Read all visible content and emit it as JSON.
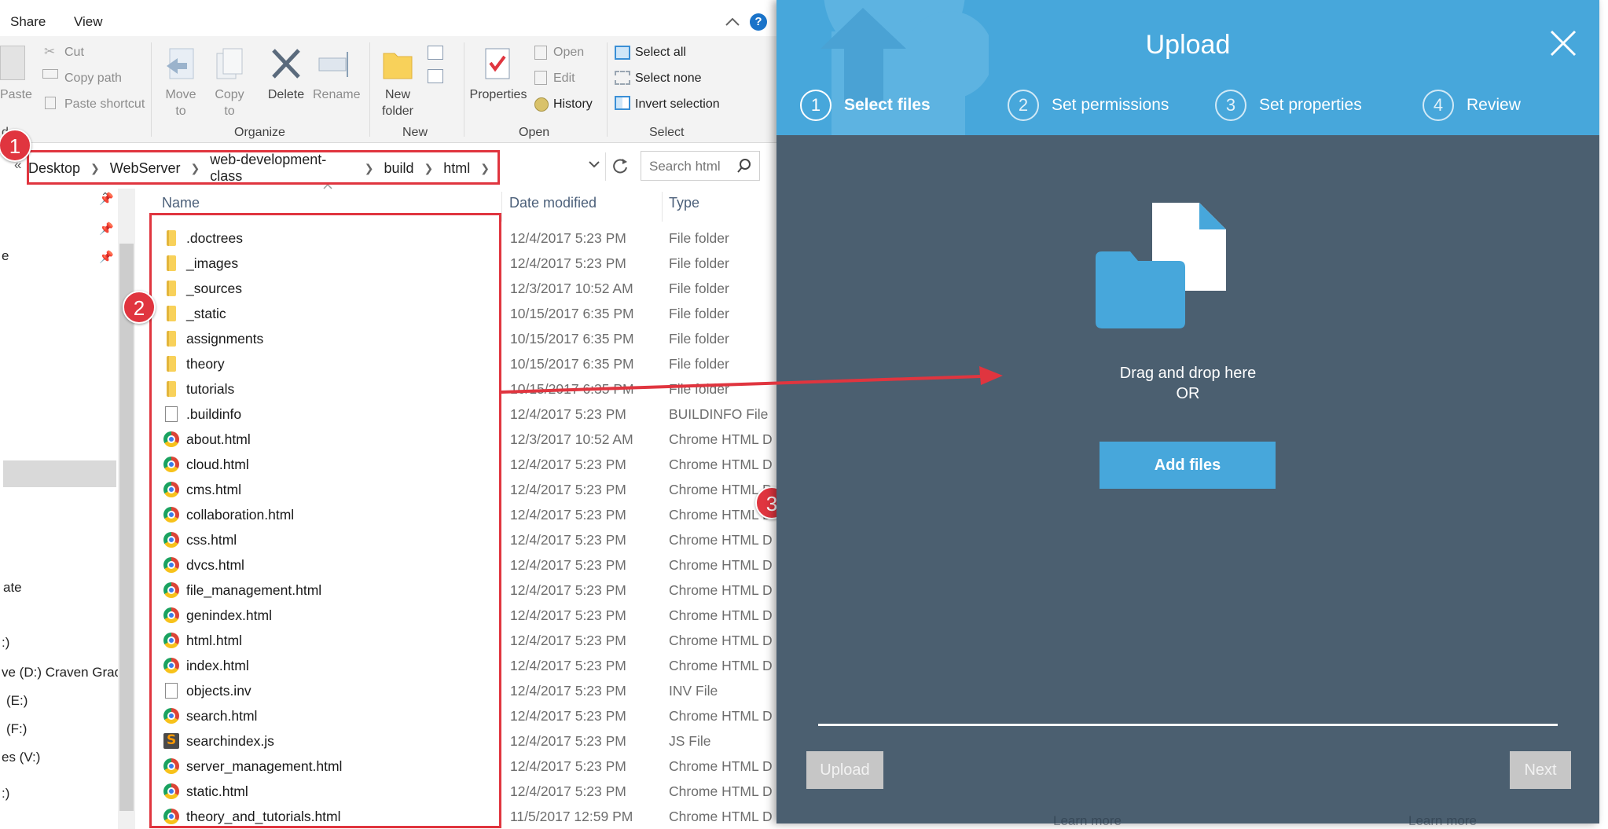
{
  "explorer": {
    "menu": [
      "Share",
      "View"
    ],
    "ribbon": {
      "clipboard": {
        "paste": "Paste",
        "cut": "Cut",
        "copy_path": "Copy path",
        "paste_shortcut": "Paste shortcut",
        "group_fragment": "d"
      },
      "organize": {
        "move_to": "Move to",
        "copy_to": "Copy to",
        "delete": "Delete",
        "rename": "Rename",
        "group": "Organize"
      },
      "new": {
        "new_folder_line1": "New",
        "new_folder_line2": "folder",
        "group": "New"
      },
      "open": {
        "properties": "Properties",
        "open": "Open",
        "edit": "Edit",
        "history": "History",
        "group": "Open"
      },
      "select": {
        "select_all": "Select all",
        "select_none": "Select none",
        "invert_selection": "Invert selection",
        "group": "Select"
      }
    },
    "breadcrumb": [
      "Desktop",
      "WebServer",
      "web-development-class",
      "build",
      "html"
    ],
    "search_placeholder": "Search html",
    "nav_fragments": [
      "e",
      "ate",
      ":)",
      "ve (D:) Craven Grad",
      "(E:)",
      "(F:)",
      "es (V:)",
      ":)"
    ],
    "columns": {
      "name": "Name",
      "date": "Date modified",
      "type": "Type"
    },
    "files": [
      {
        "name": ".doctrees",
        "date": "12/4/2017 5:23 PM",
        "type": "File folder",
        "icon": "folder-icon"
      },
      {
        "name": "_images",
        "date": "12/4/2017 5:23 PM",
        "type": "File folder",
        "icon": "folder-icon"
      },
      {
        "name": "_sources",
        "date": "12/3/2017 10:52 AM",
        "type": "File folder",
        "icon": "folder-icon"
      },
      {
        "name": "_static",
        "date": "10/15/2017 6:35 PM",
        "type": "File folder",
        "icon": "folder-icon"
      },
      {
        "name": "assignments",
        "date": "10/15/2017 6:35 PM",
        "type": "File folder",
        "icon": "folder-icon"
      },
      {
        "name": "theory",
        "date": "10/15/2017 6:35 PM",
        "type": "File folder",
        "icon": "folder-icon"
      },
      {
        "name": "tutorials",
        "date": "10/15/2017 6:35 PM",
        "type": "File folder",
        "icon": "folder-icon"
      },
      {
        "name": ".buildinfo",
        "date": "12/4/2017 5:23 PM",
        "type": "BUILDINFO File",
        "icon": "file-icon"
      },
      {
        "name": "about.html",
        "date": "12/3/2017 10:52 AM",
        "type": "Chrome HTML D",
        "icon": "chrome-icon"
      },
      {
        "name": "cloud.html",
        "date": "12/4/2017 5:23 PM",
        "type": "Chrome HTML D",
        "icon": "chrome-icon"
      },
      {
        "name": "cms.html",
        "date": "12/4/2017 5:23 PM",
        "type": "Chrome HTML D",
        "icon": "chrome-icon"
      },
      {
        "name": "collaboration.html",
        "date": "12/4/2017 5:23 PM",
        "type": "Chrome HTML D",
        "icon": "chrome-icon"
      },
      {
        "name": "css.html",
        "date": "12/4/2017 5:23 PM",
        "type": "Chrome HTML D",
        "icon": "chrome-icon"
      },
      {
        "name": "dvcs.html",
        "date": "12/4/2017 5:23 PM",
        "type": "Chrome HTML D",
        "icon": "chrome-icon"
      },
      {
        "name": "file_management.html",
        "date": "12/4/2017 5:23 PM",
        "type": "Chrome HTML D",
        "icon": "chrome-icon"
      },
      {
        "name": "genindex.html",
        "date": "12/4/2017 5:23 PM",
        "type": "Chrome HTML D",
        "icon": "chrome-icon"
      },
      {
        "name": "html.html",
        "date": "12/4/2017 5:23 PM",
        "type": "Chrome HTML D",
        "icon": "chrome-icon"
      },
      {
        "name": "index.html",
        "date": "12/4/2017 5:23 PM",
        "type": "Chrome HTML D",
        "icon": "chrome-icon"
      },
      {
        "name": "objects.inv",
        "date": "12/4/2017 5:23 PM",
        "type": "INV File",
        "icon": "file-icon"
      },
      {
        "name": "search.html",
        "date": "12/4/2017 5:23 PM",
        "type": "Chrome HTML D",
        "icon": "chrome-icon"
      },
      {
        "name": "searchindex.js",
        "date": "12/4/2017 5:23 PM",
        "type": "JS File",
        "icon": "sublime-icon"
      },
      {
        "name": "server_management.html",
        "date": "12/4/2017 5:23 PM",
        "type": "Chrome HTML D",
        "icon": "chrome-icon"
      },
      {
        "name": "static.html",
        "date": "12/4/2017 5:23 PM",
        "type": "Chrome HTML D",
        "icon": "chrome-icon"
      },
      {
        "name": "theory_and_tutorials.html",
        "date": "11/5/2017 12:59 PM",
        "type": "Chrome HTML D",
        "icon": "chrome-icon"
      }
    ]
  },
  "annotations": [
    "1",
    "2",
    "3"
  ],
  "upload": {
    "title": "Upload",
    "steps": [
      {
        "number": "1",
        "label": "Select files",
        "active": true
      },
      {
        "number": "2",
        "label": "Set permissions",
        "active": false
      },
      {
        "number": "3",
        "label": "Set properties",
        "active": false
      },
      {
        "number": "4",
        "label": "Review",
        "active": false
      }
    ],
    "drop_line1": "Drag and drop here",
    "drop_line2": "OR",
    "add_files": "Add files",
    "upload_button": "Upload",
    "next_button": "Next",
    "ghost_links": [
      "Learn more",
      "Learn more"
    ]
  },
  "colors": {
    "upload_header": "#47a7db",
    "upload_body": "#4b5f70",
    "annotation_red": "#e0353f",
    "disabled_button": "#c6c6c6"
  }
}
